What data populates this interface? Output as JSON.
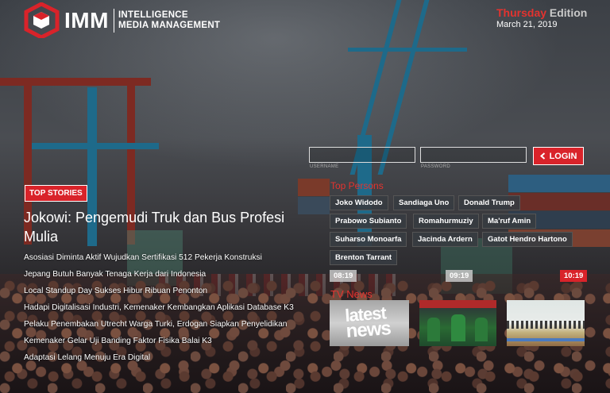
{
  "brand": {
    "logo_text": "IMM",
    "subtitle_line1": "INTELLIGENCE",
    "subtitle_line2": "MEDIA MANAGEMENT",
    "accent_color": "#d9232a"
  },
  "edition": {
    "day": "Thursday",
    "label": "Edition",
    "date": "March 21, 2019"
  },
  "login": {
    "username_label": "USERNAME",
    "password_label": "PASSWORD",
    "button_label": "LOGIN",
    "button_icon": "chevron-left-icon"
  },
  "top_stories": {
    "badge": "TOP STORIES",
    "headline": "Jokowi: Pengemudi Truk dan Bus Profesi Mulia",
    "items": [
      "Asosiasi Diminta Aktif Wujudkan Sertifikasi 512 Pekerja Konstruksi",
      "Jepang Butuh Banyak Tenaga Kerja dari Indonesia",
      "Local Standup Day Sukses Hibur Ribuan Penonton",
      "Hadapi Digitalisasi Industri, Kemenaker Kembangkan Aplikasi Database K3",
      "Pelaku Penembakan Utrecht Warga Turki, Erdogan Siapkan Penyelidikan",
      "Kemenaker Gelar Uji Banding Faktor Fisika Balai K3",
      "Adaptasi Lelang Menuju Era Digital"
    ]
  },
  "top_persons": {
    "title": "Top Persons",
    "tags": [
      "Joko Widodo",
      "Sandiaga Uno",
      "Donald Trump",
      "Prabowo Subianto",
      "Romahurmuziy",
      "Ma'ruf Amin",
      "Suharso Monoarfa",
      "Jacinda Ardern",
      "Gatot Hendro Hartono",
      "Brenton Tarrant"
    ]
  },
  "times": [
    "08:19",
    "09:19",
    "10:19"
  ],
  "tv_news": {
    "title": "TV News",
    "thumb1_text_1": "latest",
    "thumb1_text_2": "news"
  }
}
